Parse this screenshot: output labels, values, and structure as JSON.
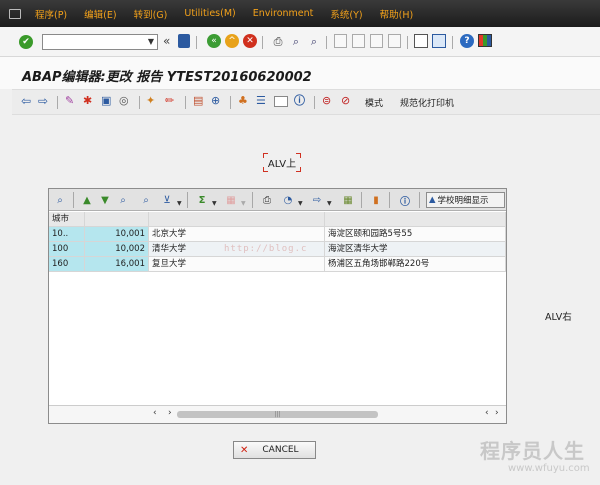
{
  "menu": {
    "items": [
      "程序(P)",
      "编辑(E)",
      "转到(G)",
      "Utilities(M)",
      "Environment",
      "系统(Y)",
      "帮助(H)"
    ]
  },
  "toolbar1": {
    "command_field_value": "",
    "icons": [
      "enter-icon",
      "save-icon",
      "back-icon",
      "exit-icon",
      "cancel-icon",
      "print-icon",
      "find-icon",
      "find-next-icon",
      "first-page-icon",
      "previous-page-icon",
      "next-page-icon",
      "last-page-icon",
      "new-session-icon",
      "shortcut-icon",
      "help-icon",
      "customize-layout-icon"
    ]
  },
  "title": "ABAP编辑器:更改 报告 YTEST20160620002",
  "toolbar2": {
    "mode_label": "模式",
    "pretty_printer_label": "规范化打印机"
  },
  "content": {
    "alv_top_label": "ALV上",
    "alv_right_label": "ALV右"
  },
  "alv": {
    "detail_button_label": "学校明细显示",
    "columns": [
      "城市",
      "",
      "",
      ""
    ],
    "rows": [
      [
        "10..",
        "10,001",
        "北京大学",
        "海淀区颐和园路5号55"
      ],
      [
        "100",
        "10,002",
        "清华大学",
        "海淀区清华大学"
      ],
      [
        "160",
        "16,001",
        "复旦大学",
        "杨浦区五角场邯郸路220号"
      ]
    ],
    "horizontal_scroll": {
      "thumb_fraction": 0.67
    }
  },
  "cancel_button": {
    "label": "CANCEL"
  },
  "watermark": {
    "url_text": "http://blog.c",
    "brand": "程序员人生",
    "site": "www.wfuyu.com"
  }
}
